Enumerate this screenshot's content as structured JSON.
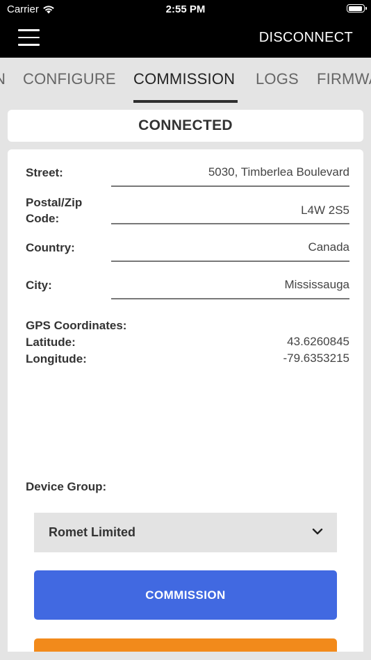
{
  "status_bar": {
    "carrier": "Carrier",
    "time": "2:55 PM"
  },
  "header": {
    "disconnect_label": "DISCONNECT"
  },
  "tabs": [
    {
      "label": "N"
    },
    {
      "label": "CONFIGURE"
    },
    {
      "label": "COMMISSION",
      "active": true
    },
    {
      "label": "LOGS"
    },
    {
      "label": "FIRMWA"
    }
  ],
  "connection_status": "CONNECTED",
  "form": {
    "street_label": "Street:",
    "street_value": "5030, Timberlea Boulevard",
    "postal_label_line1": "Postal/Zip",
    "postal_label_line2": "Code:",
    "postal_value": "L4W 2S5",
    "country_label": "Country:",
    "country_value": "Canada",
    "city_label": "City:",
    "city_value": "Mississauga",
    "gps_label": "GPS Coordinates:",
    "latitude_label": "Latitude:",
    "latitude_value": "43.6260845",
    "longitude_label": "Longitude:",
    "longitude_value": "-79.6353215",
    "device_group_label": "Device Group:",
    "device_group_selected": "Romet Limited",
    "commission_button": "COMMISSION"
  },
  "colors": {
    "header_bg": "#000000",
    "primary_button": "#4169e1",
    "secondary_button": "#f28a1b",
    "page_bg": "#e4e4e4"
  },
  "icons": {
    "menu": "hamburger-menu-icon",
    "wifi": "wifi-icon",
    "battery": "battery-icon",
    "dropdown": "chevron-down-icon"
  }
}
